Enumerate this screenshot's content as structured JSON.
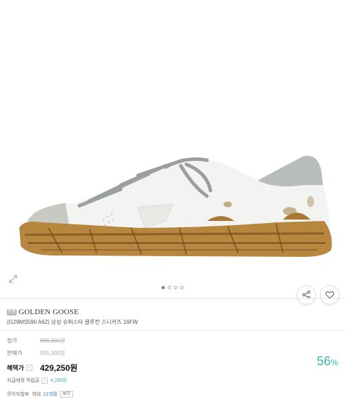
{
  "product": {
    "brand": "GOLDEN GOOSE",
    "brand_badge": "브랜드",
    "name": "(G29MS590 A62) 남성 슈퍼스타 클루칸 스니커즈 16FW",
    "image_alt": "sneaker-photo"
  },
  "gallery": {
    "slide_count": 4,
    "active_index": 0
  },
  "icons": {
    "zoom": "expand-icon",
    "share": "share-icon",
    "wishlist": "heart-icon"
  },
  "pricing": {
    "list_label": "정가",
    "list_price": "966,000원",
    "sale_label": "판매가",
    "sale_price": "505,000원",
    "benefit_label": "혜택가",
    "benefit_price": "429,250원",
    "discount_value": "56",
    "discount_unit": "%",
    "points_label": "지급예정 적립금",
    "points_value": "4,290원",
    "installment_label": "무이자할부",
    "installment_text_pre": "최대",
    "installment_months": "12개월",
    "installment_button": "보기"
  },
  "colors": {
    "accent": "#3cb4a8",
    "installment": "#3a7bd5"
  }
}
